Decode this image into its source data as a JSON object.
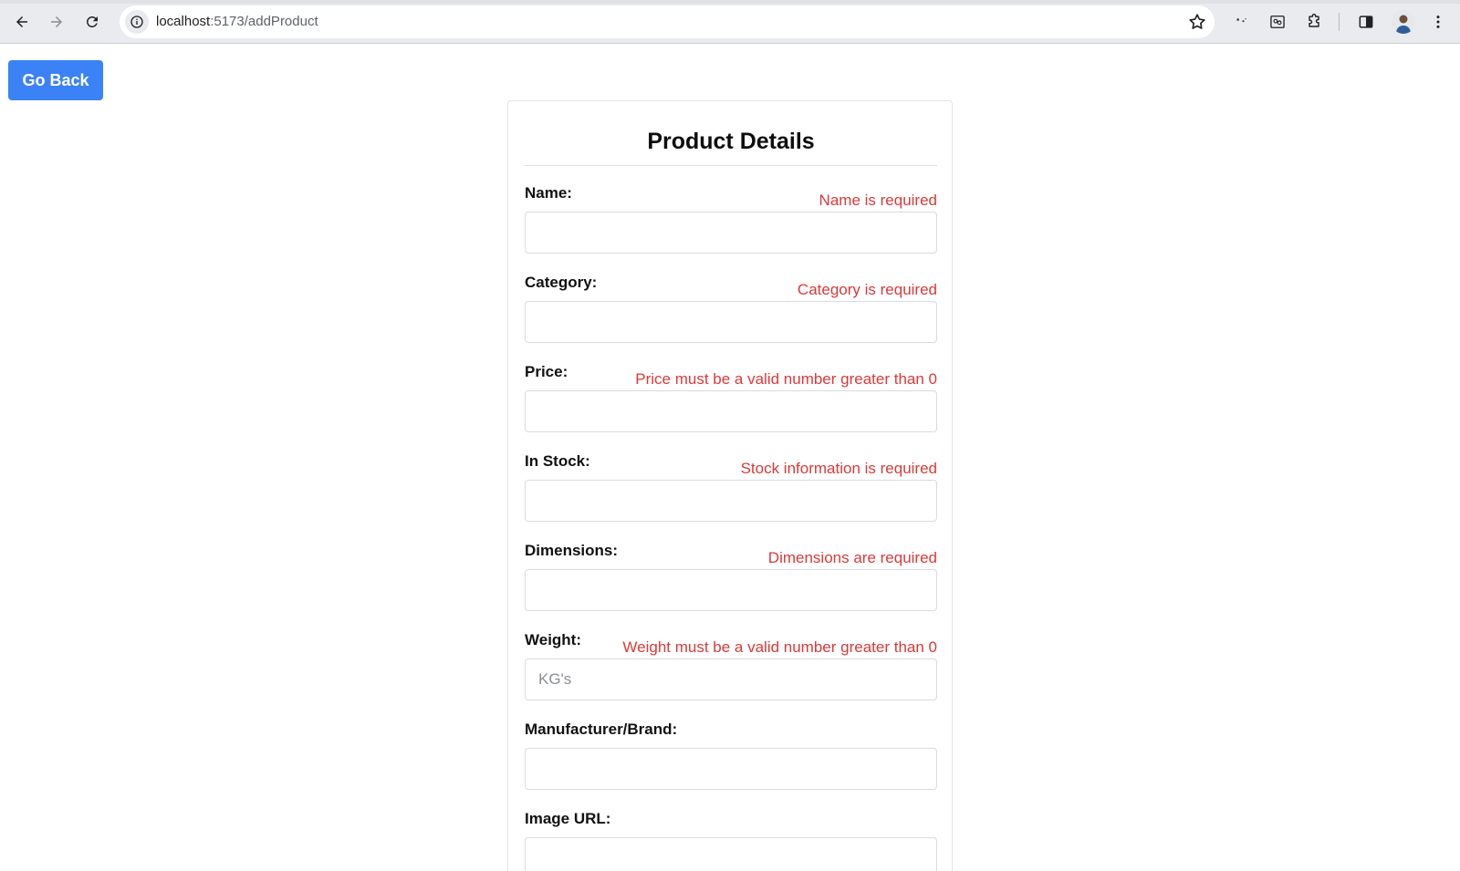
{
  "browser": {
    "url_host": "localhost",
    "url_path": ":5173/addProduct"
  },
  "page": {
    "back_button": "Go Back",
    "form": {
      "title": "Product Details",
      "fields": [
        {
          "label": "Name:",
          "error": "Name is required",
          "placeholder": "",
          "value": ""
        },
        {
          "label": "Category:",
          "error": "Category is required",
          "placeholder": "",
          "value": ""
        },
        {
          "label": "Price:",
          "error": "Price must be a valid number greater than 0",
          "placeholder": "",
          "value": ""
        },
        {
          "label": "In Stock:",
          "error": "Stock information is required",
          "placeholder": "",
          "value": ""
        },
        {
          "label": "Dimensions:",
          "error": "Dimensions are required",
          "placeholder": "",
          "value": ""
        },
        {
          "label": "Weight:",
          "error": "Weight must be a valid number greater than 0",
          "placeholder": "KG's",
          "value": ""
        },
        {
          "label": "Manufacturer/Brand:",
          "error": "",
          "placeholder": "",
          "value": ""
        },
        {
          "label": "Image URL:",
          "error": "",
          "placeholder": "",
          "value": ""
        }
      ]
    }
  },
  "colors": {
    "accent": "#3b82f6",
    "error": "#d93a3a",
    "chrome_bg": "#e9ebee"
  },
  "icons": [
    "back-arrow-icon",
    "forward-arrow-icon",
    "reload-icon",
    "site-info-icon",
    "bookmark-star-icon",
    "extension-dots-icon",
    "screenshot-icon",
    "puzzle-icon",
    "side-panel-icon",
    "profile-avatar-icon",
    "kebab-menu-icon"
  ]
}
